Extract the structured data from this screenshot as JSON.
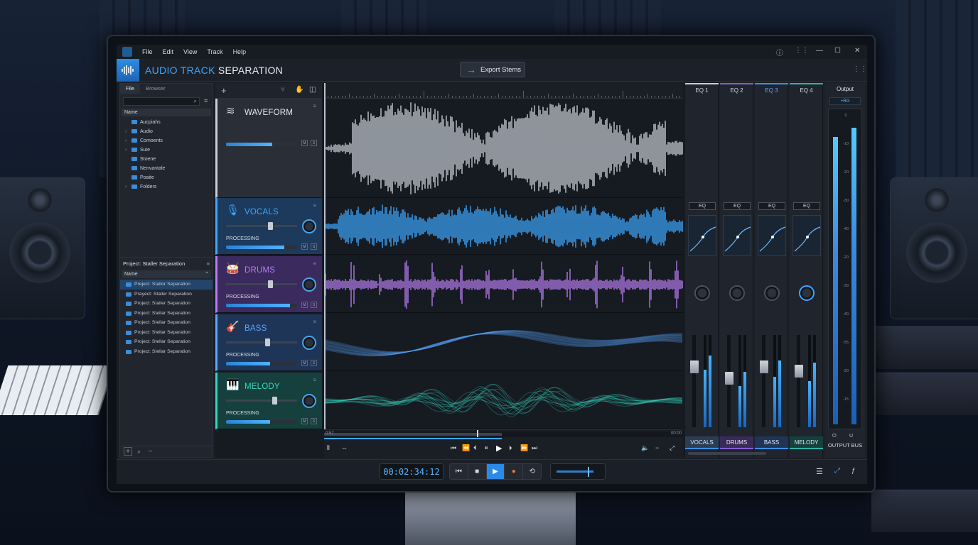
{
  "menu": {
    "file": "File",
    "edit": "Edit",
    "view": "View",
    "track": "Track",
    "help": "Help"
  },
  "app": {
    "title_accent": "AUDIO TRACK",
    "title_rest": " SEPARATION"
  },
  "export_label": "Export Stems",
  "left_tabs": {
    "file": "File",
    "browser": "Browser"
  },
  "browser": {
    "header": "Name",
    "items": [
      {
        "label": "Aucpiahs",
        "expand": ""
      },
      {
        "label": "Audio",
        "expand": "›"
      },
      {
        "label": "Comoents",
        "expand": "›"
      },
      {
        "label": "Suie",
        "expand": "›"
      },
      {
        "label": "Stoene",
        "expand": ""
      },
      {
        "label": "Nenvantale",
        "expand": ""
      },
      {
        "label": "Poaite",
        "expand": ""
      },
      {
        "label": "Folders",
        "expand": "›"
      }
    ]
  },
  "project": {
    "title": "Project: Staller Separation",
    "header": "Name",
    "items": [
      "Preject: Stallor Separation",
      "Prayect: Staller Separation",
      "Project: Staller Separation",
      "Project: Stellar Separation",
      "Project: Stellar Separation",
      "Project: Stellar Separation",
      "Project: Stellar Separation",
      "Project: Stellar Separation"
    ]
  },
  "tracks": [
    {
      "name": "WAVEFORM",
      "processing": "",
      "meter": 0.65,
      "slider": null,
      "color": "#c9ced6",
      "bg": "#2a2f37"
    },
    {
      "name": "VOCALS",
      "processing": "PROCESSING",
      "meter": 0.82,
      "slider": 0.62,
      "color": "#3ca7ff",
      "bg": "#1d3a5c"
    },
    {
      "name": "DRUMS",
      "processing": "PROCESSING",
      "meter": 0.9,
      "slider": 0.62,
      "color": "#b67cf0",
      "bg": "#3b2a5e"
    },
    {
      "name": "BASS",
      "processing": "PROCESSING",
      "meter": 0.62,
      "slider": 0.58,
      "color": "#5aa6ff",
      "bg": "#1f3558"
    },
    {
      "name": "MELODY",
      "processing": "PROCESSING",
      "meter": 0.62,
      "slider": 0.68,
      "color": "#35d6be",
      "bg": "#15403e"
    }
  ],
  "ruler": {
    "start": "0:57",
    "end": "00:00"
  },
  "mixer": {
    "channels": [
      {
        "eq": "EQ 1",
        "eq_select": "EQ",
        "name": "VOCALS",
        "vu1": 0.62,
        "vu2": 0.78,
        "fader": 0.72,
        "color": "#2a3d55"
      },
      {
        "eq": "EQ 2",
        "eq_select": "EQ",
        "name": "DRUMS",
        "vu1": 0.45,
        "vu2": 0.6,
        "fader": 0.6,
        "color": "#3a2a5a"
      },
      {
        "eq": "EQ 3",
        "eq_select": "EQ",
        "name": "BASS",
        "vu1": 0.55,
        "vu2": 0.72,
        "fader": 0.72,
        "color": "#1f3558"
      },
      {
        "eq": "EQ 4",
        "eq_select": "EQ",
        "name": "MELODY",
        "vu1": 0.5,
        "vu2": 0.7,
        "fader": 0.68,
        "color": "#15403e"
      }
    ],
    "output": {
      "label": "Output",
      "readout": "+RG",
      "name": "OUTPUT BUS",
      "scale": [
        "0",
        "-10",
        "-20",
        "-30",
        "-40",
        "-20",
        "-30",
        "-40",
        "-55",
        "-20",
        "-15"
      ],
      "left": 0.92,
      "right": 0.95
    }
  },
  "timecode": "00:02:34:12",
  "icons": {
    "search": "search-icon",
    "menu": "hamburger-icon",
    "play": "play-icon",
    "stop": "stop-icon",
    "record": "record-icon",
    "loop": "loop-icon"
  }
}
